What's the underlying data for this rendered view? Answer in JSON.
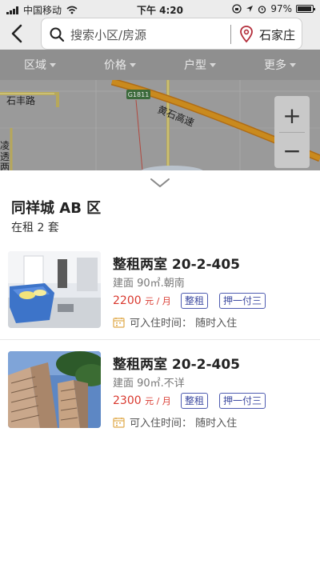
{
  "status_bar": {
    "carrier": "中国移动",
    "time": "下午 4:20",
    "battery": "97%"
  },
  "search": {
    "placeholder": "搜索小区/房源",
    "city": "石家庄"
  },
  "filters": [
    "区域",
    "价格",
    "户型",
    "更多"
  ],
  "map": {
    "labels": {
      "road_shifeng": "石丰路",
      "highway_code": "G1811",
      "highway_name": "黄石高速",
      "side_1": "凌",
      "side_2": "透",
      "side_3": "两"
    },
    "zoom_in": "+",
    "zoom_out": "−"
  },
  "estate": {
    "name": "同祥城 AB 区",
    "count": "在租 2 套"
  },
  "listings": [
    {
      "title": "整租两室 20-2-405",
      "info": "建面 90㎡.朝南",
      "price": "2200",
      "price_unit": "元 / 月",
      "tags": [
        "整租",
        "押一付三"
      ],
      "availability": "可入住时间：  随时入住"
    },
    {
      "title": "整租两室 20-2-405",
      "info": "建面 90㎡.不详",
      "price": "2300",
      "price_unit": "元 / 月",
      "tags": [
        "整租",
        "押一付三"
      ],
      "availability": "可入住时间：  随时入住"
    }
  ],
  "colors": {
    "accent_tag": "#3d4aa0",
    "price": "#d9392f",
    "map_road": "#c98a1e"
  }
}
